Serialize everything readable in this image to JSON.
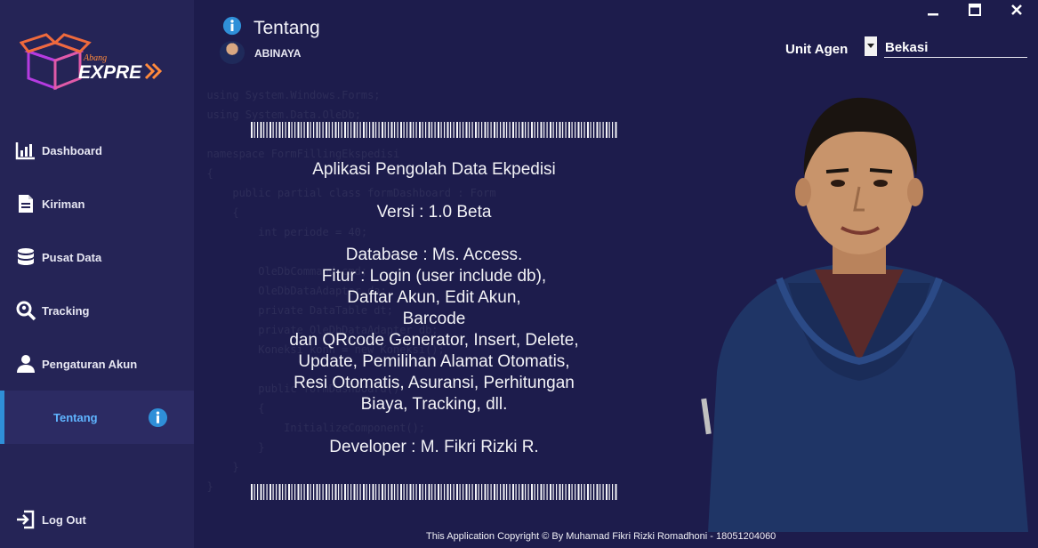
{
  "app": {
    "logo_small": "Abang",
    "logo_main": "EXPRESS"
  },
  "sidebar": {
    "items": [
      {
        "label": "Dashboard",
        "icon": "bar-chart-icon"
      },
      {
        "label": "Kiriman",
        "icon": "document-icon"
      },
      {
        "label": "Pusat Data",
        "icon": "database-icon"
      },
      {
        "label": "Tracking",
        "icon": "magnifier-icon"
      },
      {
        "label": "Pengaturan Akun",
        "icon": "user-icon"
      },
      {
        "label": "Tentang",
        "icon": "info-icon"
      }
    ],
    "logout": "Log Out"
  },
  "header": {
    "title": "Tentang",
    "user": "ABINAYA",
    "unit_label": "Unit Agen",
    "unit_value": "Bekasi"
  },
  "about": {
    "app_name": "Aplikasi Pengolah Data Ekpedisi",
    "version": "Versi : 1.0 Beta",
    "lines": [
      "Database : Ms. Access.",
      "Fitur : Login (user include db),",
      "Daftar Akun, Edit Akun,",
      "Barcode",
      "dan QRcode Generator, Insert, Delete,",
      "Update, Pemilihan Alamat Otomatis,",
      "Resi Otomatis, Asuransi, Perhitungan",
      "Biaya, Tracking, dll."
    ],
    "developer": "Developer : M. Fikri Rizki R."
  },
  "footer": {
    "copyright": "This Application Copyright © By Muhamad Fikri Rizki Romadhoni - 18051204060"
  },
  "colors": {
    "sidebar_bg": "#252456",
    "main_bg": "#1d1c4c",
    "accent": "#2f8fd8",
    "active_text": "#5fb4ff"
  }
}
